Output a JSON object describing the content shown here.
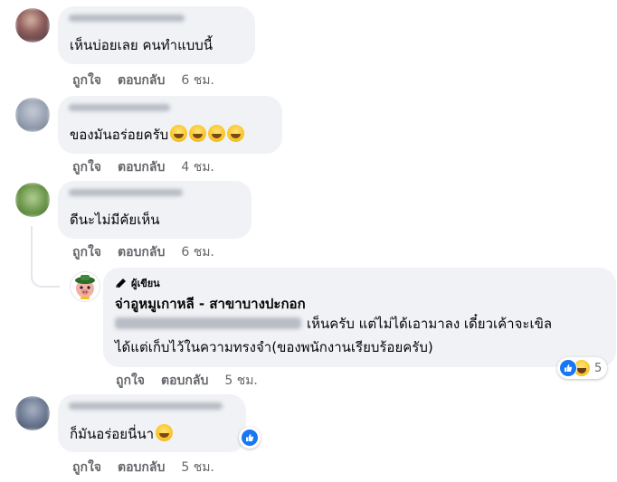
{
  "comments": [
    {
      "text": "เห็นบ่อยเลย คนทำแบบนี้",
      "like_label": "ถูกใจ",
      "reply_label": "ตอบกลับ",
      "time": "6 ชม."
    },
    {
      "text": "ของมันอร่อยครับ",
      "like_label": "ถูกใจ",
      "reply_label": "ตอบกลับ",
      "time": "4 ชม."
    },
    {
      "text": "ดีนะไม่มีคัยเห็น",
      "like_label": "ถูกใจ",
      "reply_label": "ตอบกลับ",
      "time": "6 ชม."
    },
    {
      "text": "ก็มันอร่อยนี่นา",
      "like_label": "ถูกใจ",
      "reply_label": "ตอบกลับ",
      "time": "5 ชม."
    }
  ],
  "reply": {
    "badge": "ผู้เขียน",
    "page_name": "จ่าอูหมูเกาหลี - สาขาบางปะกอก",
    "line1": "เห็นครับ แต่ไม่ได้เอามาลง เดี๋ยวเค้าจะเขิล",
    "line2": "ได้แต่เก็บไว้ในความทรงจำ(ของพนักงานเรียบร้อยครับ)",
    "reaction_count": "5",
    "like_label": "ถูกใจ",
    "reply_label": "ตอบกลับ",
    "time": "5 ชม."
  },
  "icons": {
    "author": "pencil-icon",
    "reaction_like": "thumbs-up-icon",
    "reaction_haha": "laughing-face-icon",
    "emoji": "grinning-face-icon"
  },
  "colors": {
    "bubble": "#f0f2f5",
    "meta_text": "#65676b",
    "like_blue": "#1877f2"
  }
}
